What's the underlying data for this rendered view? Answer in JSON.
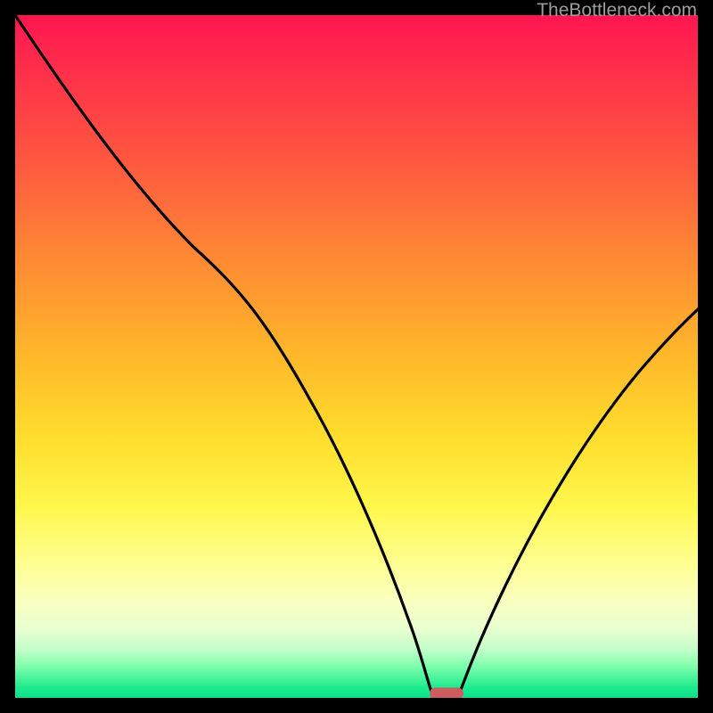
{
  "watermark": "TheBottleneck.com",
  "marker": {
    "x_pct": 62,
    "y_pct": 99.4,
    "color": "#cd5e60"
  },
  "chart_data": {
    "type": "line",
    "title": "",
    "xlabel": "",
    "ylabel": "",
    "xlim": [
      0,
      100
    ],
    "ylim": [
      0,
      100
    ],
    "grid": false,
    "legend": null,
    "series": [
      {
        "name": "bottleneck-curve",
        "x": [
          0,
          5,
          10,
          15,
          20,
          25,
          30,
          35,
          40,
          45,
          50,
          55,
          58,
          60,
          62,
          64,
          66,
          70,
          75,
          80,
          85,
          90,
          95,
          100
        ],
        "y": [
          100,
          92,
          84,
          76,
          70,
          66,
          60,
          52,
          44,
          35,
          26,
          16,
          8,
          3,
          0,
          0,
          2,
          8,
          17,
          27,
          37,
          46,
          53,
          58
        ]
      }
    ],
    "gradient_stops": [
      {
        "pct": 0,
        "color": "#ff1650"
      },
      {
        "pct": 22,
        "color": "#ff5a3f"
      },
      {
        "pct": 50,
        "color": "#ffb82a"
      },
      {
        "pct": 72,
        "color": "#fff74c"
      },
      {
        "pct": 86,
        "color": "#f9ffc1"
      },
      {
        "pct": 95,
        "color": "#8affb0"
      },
      {
        "pct": 100,
        "color": "#0be38a"
      }
    ],
    "annotations": [
      {
        "type": "watermark",
        "text": "TheBottleneck.com",
        "position": "top-right"
      }
    ]
  }
}
